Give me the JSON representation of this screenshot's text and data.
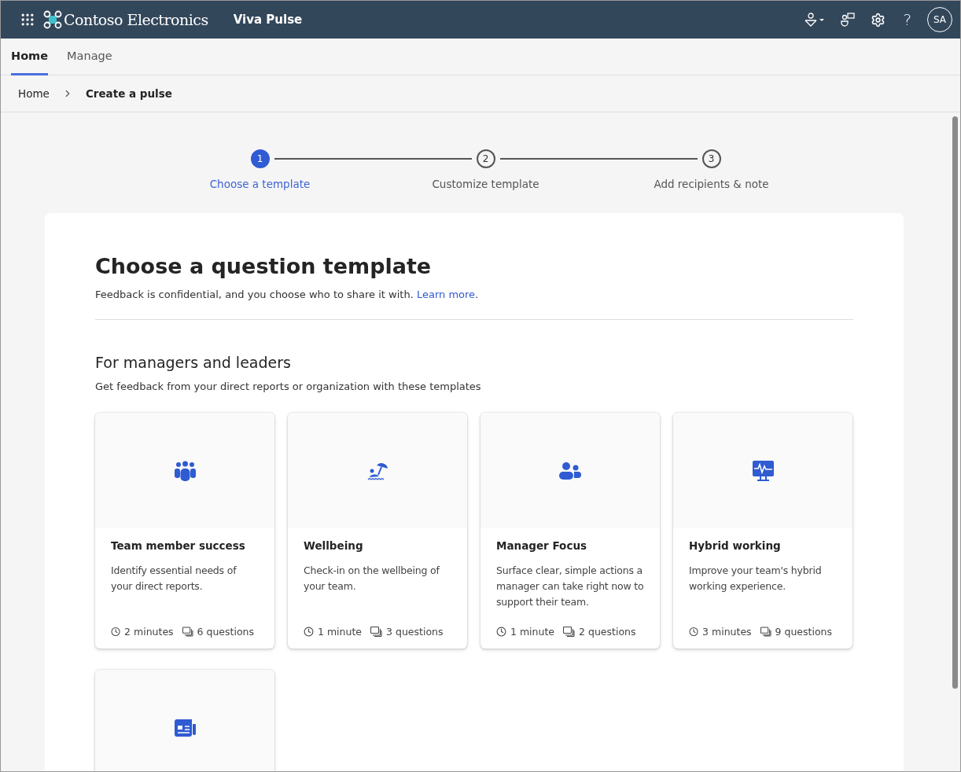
{
  "header": {
    "brand": "Contoso Electronics",
    "app": "Viva Pulse",
    "help": "?",
    "avatar": "SA"
  },
  "nav_tabs": [
    {
      "label": "Home",
      "selected": true
    },
    {
      "label": "Manage",
      "selected": false
    }
  ],
  "breadcrumb": [
    {
      "label": "Home",
      "current": false
    },
    {
      "label": "Create a pulse",
      "current": true
    }
  ],
  "stepper": [
    {
      "number": "1",
      "label": "Choose a template",
      "selected": true
    },
    {
      "number": "2",
      "label": "Customize template",
      "selected": false
    },
    {
      "number": "3",
      "label": "Add recipients & note",
      "selected": false
    }
  ],
  "panel": {
    "title": "Choose a question template",
    "subtitle": "Feedback is confidential, and you choose who to share it with.",
    "link": "Learn more",
    "end": "."
  },
  "section": {
    "title": "For managers and leaders",
    "subtitle": "Get feedback from your direct reports or organization with these templates"
  },
  "templates": [
    {
      "kind": "team",
      "title": "Team member success",
      "description": "Identify essential needs of your direct reports.",
      "duration": "2 minutes",
      "questions": "6 questions"
    },
    {
      "kind": "beach",
      "title": "Wellbeing",
      "description": "Check-in on the wellbeing of your team.",
      "duration": "1 minute",
      "questions": "3 questions"
    },
    {
      "kind": "people",
      "title": "Manager Focus",
      "description": "Surface clear, simple actions a manager can take right now to support their team.",
      "duration": "1 minute",
      "questions": "2 questions"
    },
    {
      "kind": "monitor",
      "title": "Hybrid working",
      "description": "Improve your team's hybrid working experience.",
      "duration": "3 minutes",
      "questions": "9 questions"
    },
    {
      "kind": "news"
    }
  ]
}
